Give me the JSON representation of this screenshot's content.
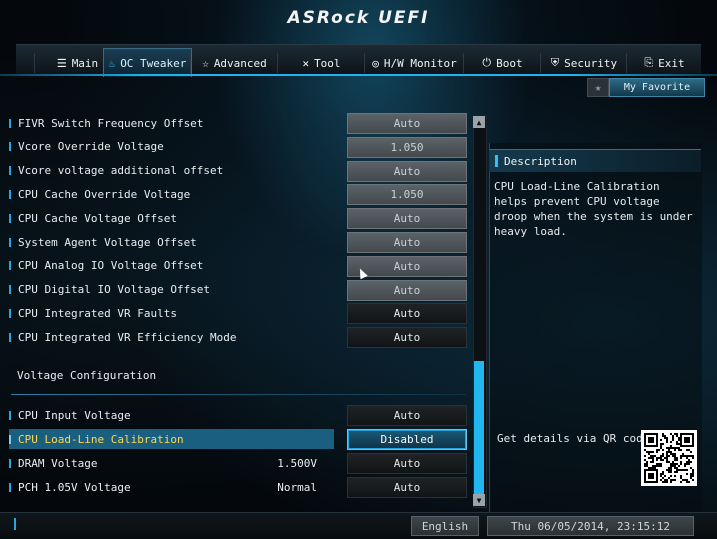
{
  "header": {
    "logo_text": "ASRock UEFI"
  },
  "tabs": [
    {
      "label": "Main",
      "icon": "list-icon",
      "glyph": "☰"
    },
    {
      "label": "OC Tweaker",
      "icon": "flame-icon",
      "glyph": "♨",
      "active": true
    },
    {
      "label": "Advanced",
      "icon": "star-icon",
      "glyph": "☆"
    },
    {
      "label": "Tool",
      "icon": "tools-icon",
      "glyph": "✕"
    },
    {
      "label": "H/W Monitor",
      "icon": "monitor-icon",
      "glyph": "◎"
    },
    {
      "label": "Boot",
      "icon": "power-icon",
      "glyph": "⏻"
    },
    {
      "label": "Security",
      "icon": "shield-icon",
      "glyph": "⛨"
    },
    {
      "label": "Exit",
      "icon": "exit-icon",
      "glyph": "⎘"
    }
  ],
  "favorite": {
    "star_glyph": "★",
    "label": "My Favorite"
  },
  "settings": [
    {
      "label": "FIVR Switch Frequency Offset",
      "value": "Auto",
      "style": "gray"
    },
    {
      "label": "Vcore Override Voltage",
      "value": "1.050",
      "style": "gray"
    },
    {
      "label": "Vcore voltage additional offset",
      "value": "Auto",
      "style": "gray"
    },
    {
      "label": "CPU Cache Override Voltage",
      "value": "1.050",
      "style": "gray"
    },
    {
      "label": "CPU Cache Voltage Offset",
      "value": "Auto",
      "style": "gray"
    },
    {
      "label": "System Agent Voltage Offset",
      "value": "Auto",
      "style": "gray"
    },
    {
      "label": "CPU Analog IO Voltage Offset",
      "value": "Auto",
      "style": "gray"
    },
    {
      "label": "CPU Digital IO Voltage Offset",
      "value": "Auto",
      "style": "gray"
    },
    {
      "label": "CPU Integrated VR Faults",
      "value": "Auto",
      "style": "dark"
    },
    {
      "label": "CPU Integrated VR Efficiency Mode",
      "value": "Auto",
      "style": "dark"
    }
  ],
  "section": {
    "title": "Voltage Configuration"
  },
  "voltage_settings": [
    {
      "label": "CPU Input Voltage",
      "current": "",
      "value": "Auto",
      "style": "dark"
    },
    {
      "label": "CPU Load-Line Calibration",
      "current": "",
      "value": "Disabled",
      "style": "sel",
      "selected": true
    },
    {
      "label": "DRAM Voltage",
      "current": "1.500V",
      "value": "Auto",
      "style": "dark"
    },
    {
      "label": "PCH 1.05V Voltage",
      "current": "Normal",
      "value": "Auto",
      "style": "dark"
    }
  ],
  "scrollbar": {
    "up_glyph": "▲",
    "down_glyph": "▼"
  },
  "description": {
    "title": "Description",
    "text": "CPU Load-Line Calibration helps prevent CPU voltage droop when the system is under heavy load.",
    "qr_label": "Get details via QR code"
  },
  "footer": {
    "language": "English",
    "datetime": "Thu 06/05/2014, 23:15:12"
  },
  "colors": {
    "accent": "#1fb2f2",
    "selected_label": "#ffd84d",
    "selected_row": "#1a5f80"
  }
}
